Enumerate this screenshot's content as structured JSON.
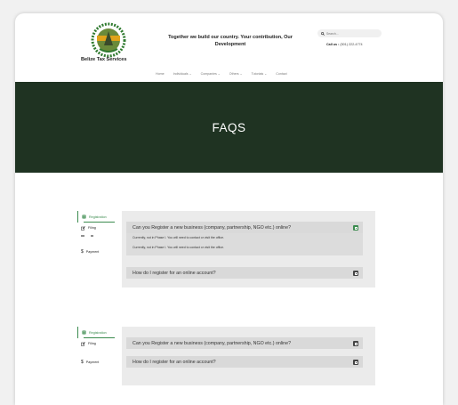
{
  "header": {
    "logo_name": "belize-tax-logo",
    "brand": "Belize Tax Services",
    "slogan": "Together we build our country. Your contribution, Our Development",
    "search_placeholder": "Search...",
    "call_label": "Call us :",
    "call_number": "(501) 222-4774"
  },
  "nav": [
    "Home",
    "Individuals ⌄",
    "Companies ⌄",
    "Others ⌄",
    "Tutorials ⌄",
    "Contact"
  ],
  "hero": {
    "title": "FAQS"
  },
  "faq_sections": [
    {
      "tabs": [
        {
          "label": "Registration",
          "icon": "registration-icon",
          "active": true
        },
        {
          "label": "Filing",
          "icon": "edit-icon",
          "active": false
        },
        {
          "label": "Payment",
          "icon": "dollar-icon",
          "active": false
        }
      ],
      "questions": [
        {
          "text": "Can you Register a new business (company, partnership, NGO etc.) online?",
          "open": true,
          "answers": [
            "Currently, not in Phase I. You will need to contact or visit the office.",
            "Currently, not in Phase I. You will need to contact or visit the office."
          ]
        },
        {
          "text": "How do I register for an online account?",
          "open": false,
          "answers": []
        }
      ]
    },
    {
      "tabs": [
        {
          "label": "Registration",
          "icon": "registration-icon",
          "active": true
        },
        {
          "label": "Filing",
          "icon": "edit-icon",
          "active": false
        },
        {
          "label": "Payment",
          "icon": "dollar-icon",
          "active": false
        }
      ],
      "questions": [
        {
          "text": "Can you Register a new business (company, partnership, NGO etc.) online?",
          "open": false,
          "answers": []
        },
        {
          "text": "How do I register for an online account?",
          "open": false,
          "answers": []
        }
      ]
    }
  ],
  "colors": {
    "hero_bg": "#1f3322",
    "accent": "#3c8c4f",
    "panel_bg": "#ebebeb"
  }
}
